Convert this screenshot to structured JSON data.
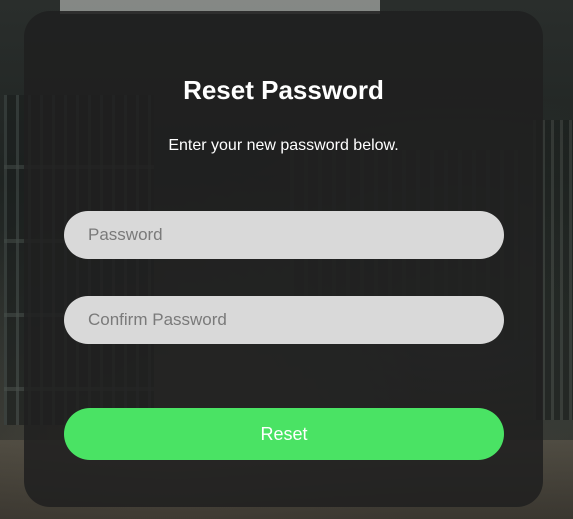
{
  "form": {
    "title": "Reset Password",
    "subtitle": "Enter your new password below.",
    "password_placeholder": "Password",
    "confirm_placeholder": "Confirm Password",
    "reset_label": "Reset"
  },
  "colors": {
    "card_background": "#201f1f",
    "input_background": "#d9d9d9",
    "button_accent": "#4ae364",
    "text": "#ffffff"
  }
}
